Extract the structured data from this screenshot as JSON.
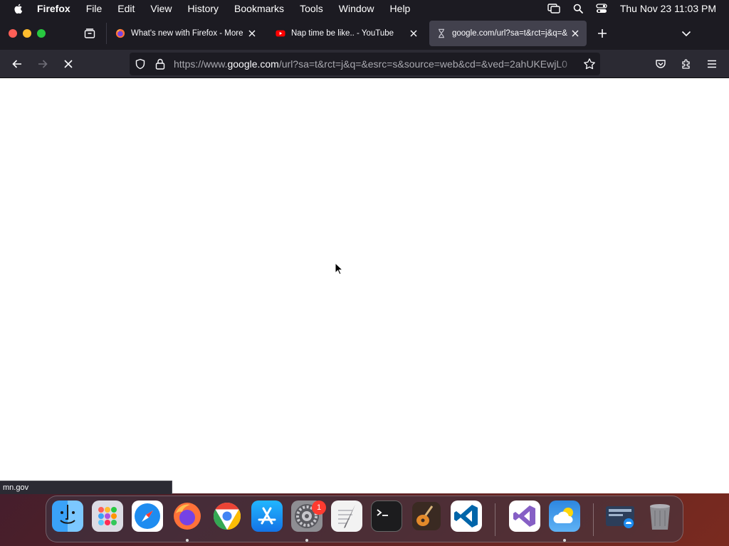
{
  "menubar": {
    "app_name": "Firefox",
    "items": [
      "File",
      "Edit",
      "View",
      "History",
      "Bookmarks",
      "Tools",
      "Window",
      "Help"
    ],
    "clock": "Thu Nov 23  11:03 PM"
  },
  "tabs": [
    {
      "title": "What's new with Firefox - More",
      "favicon": "firefox-icon",
      "active": false
    },
    {
      "title": "Nap time be like.. - YouTube",
      "favicon": "youtube-icon",
      "active": false
    },
    {
      "title": "google.com/url?sa=t&rct=j&q=&",
      "favicon": "hourglass-icon",
      "active": true
    }
  ],
  "urlbar": {
    "prefix": "https://www.",
    "host": "google.com",
    "path": "/url?sa=t&rct=j&q=&esrc=s&source=web&cd=&ved=2ahUKEwjL0"
  },
  "status": {
    "text": "mn.gov"
  },
  "dock": {
    "apps": [
      "Finder",
      "Launchpad",
      "Safari",
      "Firefox",
      "Google Chrome",
      "App Store",
      "System Settings",
      "TextEdit",
      "Terminal",
      "GarageBand",
      "Visual Studio Code",
      "Visual Studio",
      "Weather",
      "Screen Sharing",
      "Trash"
    ],
    "settings_badge": "1"
  },
  "colors": {
    "toolbar": "#2b2a33",
    "tabbar": "#1c1b22",
    "active_tab": "#42414d",
    "youtube_red": "#ff0000"
  }
}
